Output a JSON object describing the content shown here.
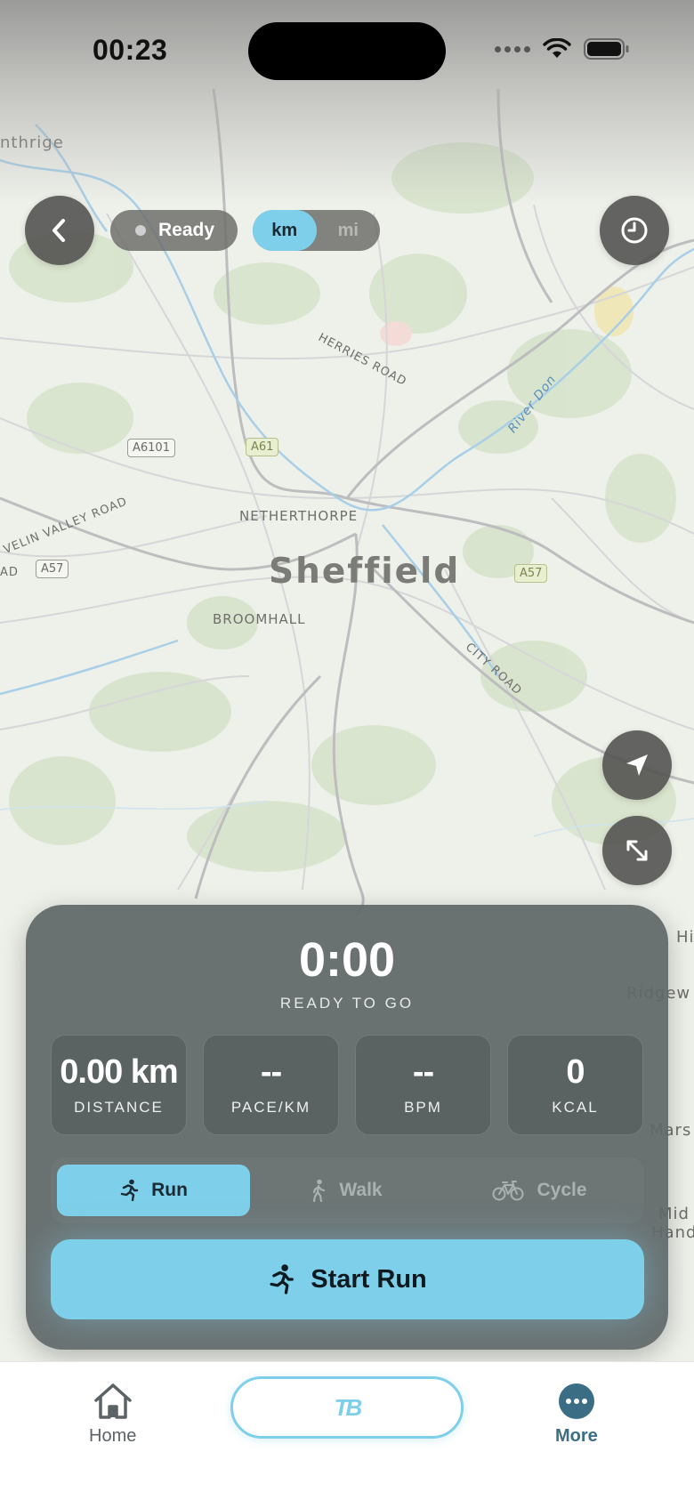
{
  "status_bar": {
    "time": "00:23"
  },
  "top_controls": {
    "status_label": "Ready",
    "units": [
      {
        "label": "km",
        "active": true
      },
      {
        "label": "mi",
        "active": false
      }
    ]
  },
  "map": {
    "city": "Sheffield",
    "labels": {
      "herries_road": "HERRIES ROAD",
      "river_don": "River Don",
      "netherthorpe": "NETHERTHORPE",
      "broomhall": "BROOMHALL",
      "city_road": "CITY ROAD",
      "rivelin_valley_road": "VELIN VALLEY ROAD",
      "hillsborough_partial": "nthrige",
      "ridgeway_partial": "Ridgew",
      "marsh_partial": "Mars",
      "mid_partial": "Mid",
      "hand_partial": "Hand",
      "hi_partial": "Hi",
      "road_partial": "AD"
    },
    "shields": {
      "a6101": "A6101",
      "a61": "A61",
      "a57_west": "A57",
      "a57_east": "A57"
    }
  },
  "panel": {
    "timer": "0:00",
    "timer_subtitle": "READY TO GO",
    "stats": [
      {
        "value": "0.00 km",
        "label": "DISTANCE"
      },
      {
        "value": "--",
        "label": "PACE/KM"
      },
      {
        "value": "--",
        "label": "BPM"
      },
      {
        "value": "0",
        "label": "KCAL"
      }
    ],
    "activities": [
      {
        "label": "Run",
        "active": true
      },
      {
        "label": "Walk",
        "active": false
      },
      {
        "label": "Cycle",
        "active": false
      }
    ],
    "start_label": "Start Run"
  },
  "tab_bar": {
    "home_label": "Home",
    "center_logo": "TB",
    "more_label": "More"
  },
  "colors": {
    "accent": "#7ecfe9",
    "panel": "#606767",
    "more_active": "#3b6e84"
  }
}
